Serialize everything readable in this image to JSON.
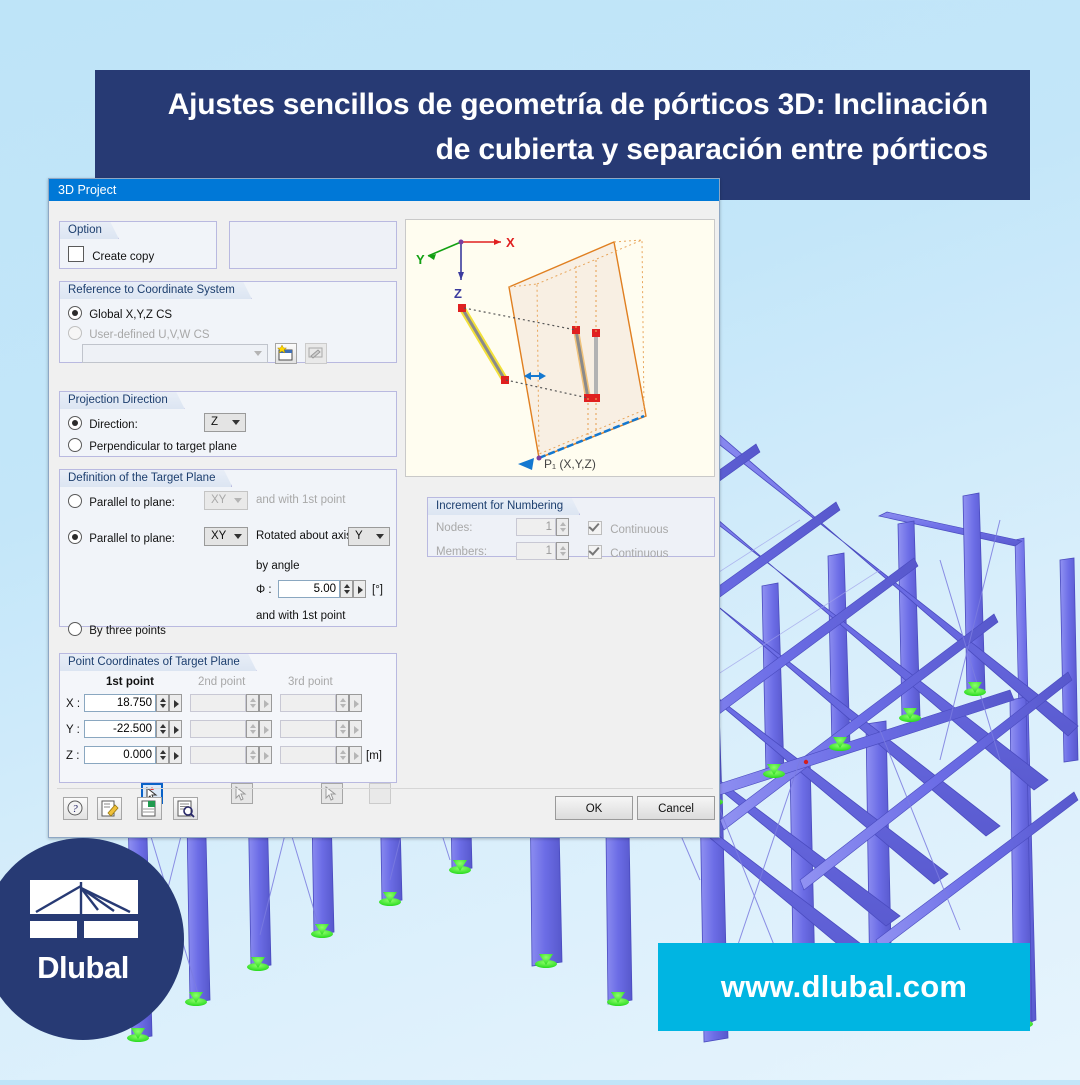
{
  "banner": {
    "line1": "Ajustes sencillos de geometría de pórticos 3D: Inclinación",
    "line2": "de cubierta y separación entre pórticos",
    "bg_color": "#273a74"
  },
  "page": {
    "background_color": "#bee4f8",
    "accent_cyan": "#00b5e2"
  },
  "dialog": {
    "title": "3D Project",
    "titlebar_color": "#0078d7",
    "option_group": {
      "title": "Option",
      "create_copy_label": "Create copy",
      "create_copy_checked": false
    },
    "coordinate_system_group": {
      "title": "Reference to Coordinate System",
      "global_label": "Global X,Y,Z CS",
      "global_selected": true,
      "user_defined_label": "User-defined U,V,W CS",
      "user_defined_selected": false,
      "cs_combo_value": "",
      "new_button": "new-cs",
      "edit_button": "edit-cs"
    },
    "projection_group": {
      "title": "Projection Direction",
      "direction_label": "Direction:",
      "direction_selected": true,
      "direction_value": "Z",
      "perpendicular_label": "Perpendicular to target plane",
      "perpendicular_selected": false
    },
    "target_plane_group": {
      "title": "Definition of the Target Plane",
      "option1_label": "Parallel to plane:",
      "option1_selected": false,
      "option1_plane": "XY",
      "option1_suffix": "and with 1st point",
      "option2_label": "Parallel to plane:",
      "option2_selected": true,
      "option2_plane": "XY",
      "rotated_label": "Rotated about axis:",
      "rotated_axis": "Y",
      "by_angle_label": "by angle",
      "angle_symbol": "Φ :",
      "angle_value": "5.00",
      "angle_unit": "[°]",
      "and_with_label": "and with 1st point",
      "option3_label": "By three points",
      "option3_selected": false
    },
    "numbering_group": {
      "title": "Increment for Numbering",
      "rows": [
        {
          "label": "Nodes:",
          "value": "1",
          "continuous_label": "Continuous",
          "continuous_checked": true
        },
        {
          "label": "Members:",
          "value": "1",
          "continuous_label": "Continuous",
          "continuous_checked": true
        }
      ]
    },
    "coordinates_group": {
      "title": "Point Coordinates of Target Plane",
      "columns": [
        "1st point",
        "2nd point",
        "3rd point"
      ],
      "unit": "[m]",
      "rows": [
        {
          "label": "X :",
          "p1": "18.750",
          "p2": "",
          "p3": ""
        },
        {
          "label": "Y :",
          "p1": "-22.500",
          "p2": "",
          "p3": ""
        },
        {
          "label": "Z :",
          "p1": "0.000",
          "p2": "",
          "p3": ""
        }
      ]
    },
    "preview": {
      "axis_x": "X",
      "axis_y": "Y",
      "axis_z": "Z",
      "point_label": "P₁ (X,Y,Z)"
    },
    "toolbar_icons": [
      "help-icon",
      "edit-icon",
      "excel-export-icon",
      "preview-icon"
    ],
    "buttons": {
      "ok": "OK",
      "cancel": "Cancel"
    }
  },
  "footer": {
    "url": "www.dlubal.com",
    "logo_text": "Dlubal"
  }
}
